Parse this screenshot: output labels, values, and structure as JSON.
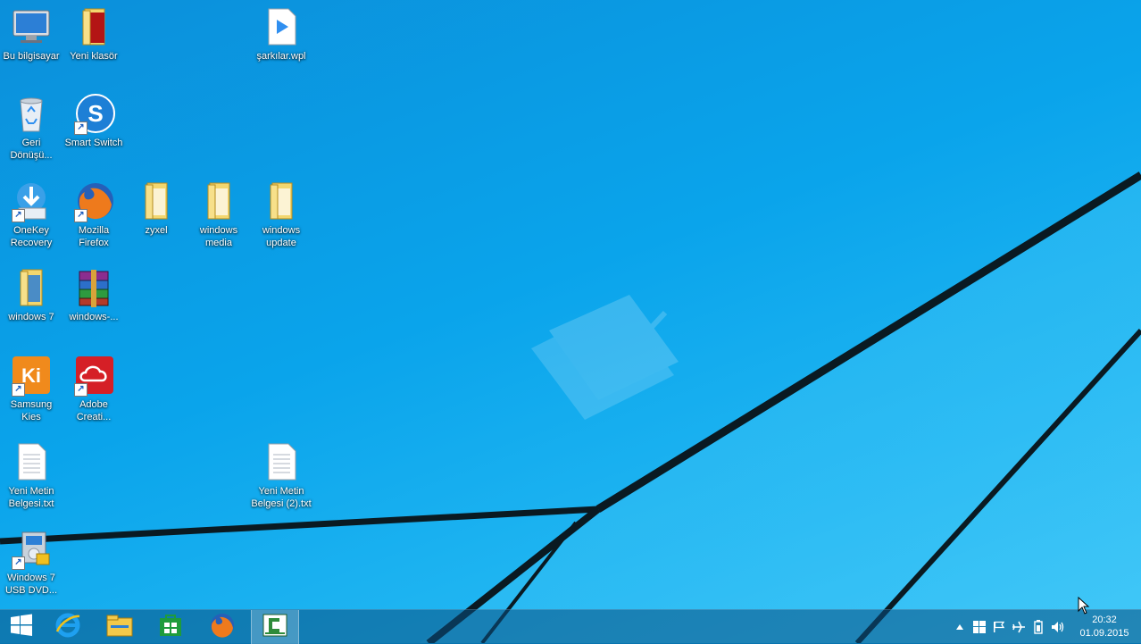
{
  "desktop": {
    "icons": [
      {
        "label": "Bu bilgisayar",
        "icon": "computer-icon"
      },
      {
        "label": "Yeni klasör",
        "icon": "folder-icon"
      },
      {
        "label": "şarkılar.wpl",
        "icon": "playlist-icon"
      },
      {
        "label": "Geri Dönüşü...",
        "icon": "recycle-bin-icon"
      },
      {
        "label": "Smart Switch",
        "icon": "smart-switch-icon"
      },
      {
        "label": "OneKey Recovery",
        "icon": "onekey-recovery-icon"
      },
      {
        "label": "Mozilla Firefox",
        "icon": "firefox-icon"
      },
      {
        "label": "zyxel",
        "icon": "folder-icon"
      },
      {
        "label": "windows media",
        "icon": "folder-icon"
      },
      {
        "label": "windows update",
        "icon": "folder-icon"
      },
      {
        "label": "windows 7",
        "icon": "folder-icon"
      },
      {
        "label": "windows-...",
        "icon": "winrar-archive-icon"
      },
      {
        "label": "Samsung Kies",
        "icon": "samsung-kies-icon"
      },
      {
        "label": "Adobe Creati...",
        "icon": "adobe-creative-cloud-icon"
      },
      {
        "label": "Yeni Metin Belgesi.txt",
        "icon": "text-file-icon"
      },
      {
        "label": "Yeni Metin Belgesi (2).txt",
        "icon": "text-file-icon"
      },
      {
        "label": "Windows 7 USB DVD...",
        "icon": "windows-usb-dvd-tool-icon"
      }
    ]
  },
  "taskbar": {
    "buttons": [
      {
        "name": "start",
        "icon": "windows-start-icon"
      },
      {
        "name": "internet-explorer",
        "icon": "internet-explorer-icon"
      },
      {
        "name": "file-explorer",
        "icon": "file-explorer-icon"
      },
      {
        "name": "store",
        "icon": "store-icon"
      },
      {
        "name": "firefox",
        "icon": "firefox-icon"
      },
      {
        "name": "camtasia",
        "icon": "camtasia-icon",
        "active": true
      }
    ],
    "tray": {
      "icons": [
        "show-hidden-icons-chevron-icon",
        "windows-icon",
        "action-center-flag-icon",
        "airplane-mode-icon",
        "battery-icon",
        "volume-icon"
      ],
      "time": "20:32",
      "date": "01.09.2015"
    }
  },
  "colors": {
    "wallpaper": "#0aa0e6",
    "taskbar": "#0a5082",
    "label_text": "#ffffff"
  }
}
